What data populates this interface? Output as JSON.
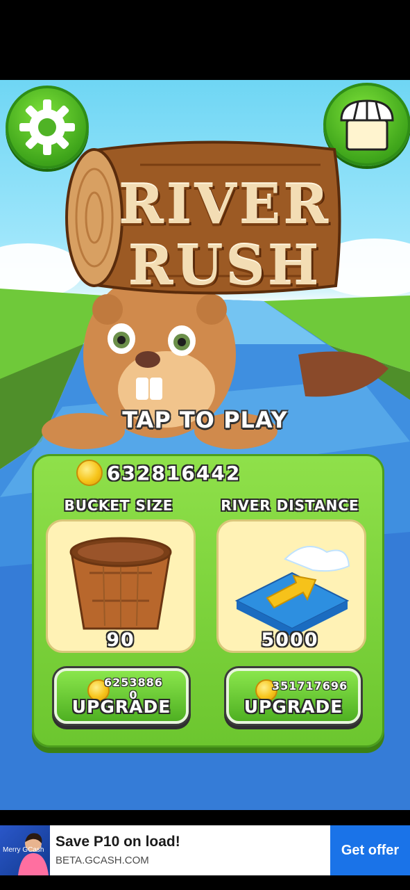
{
  "game": {
    "title_line1": "RIVER",
    "title_line2": "RUSH",
    "tap_prompt": "TAP TO PLAY",
    "coin_balance": "632816442",
    "icons": {
      "settings": "gear-icon",
      "shop": "shop-awning-icon",
      "coin": "coin-icon"
    }
  },
  "upgrades": [
    {
      "title": "BUCKET SIZE",
      "value": "90",
      "cost_line1": "6253886",
      "cost_line2": "0",
      "button_label": "UPGRADE",
      "icon": "bucket-icon"
    },
    {
      "title": "RIVER DISTANCE",
      "value": "5000",
      "cost_line1": "351717696",
      "button_label": "UPGRADE",
      "icon": "river-wave-arrow-icon"
    }
  ],
  "ad": {
    "image_text": "Merry GCash",
    "title": "Save P10 on load!",
    "url": "BETA.GCASH.COM",
    "cta": "Get offer"
  },
  "colors": {
    "panel_green": "#6cc62f",
    "card_cream": "#fff2b5",
    "cta_blue": "#1a73e8",
    "log_brown": "#9c5a24"
  }
}
